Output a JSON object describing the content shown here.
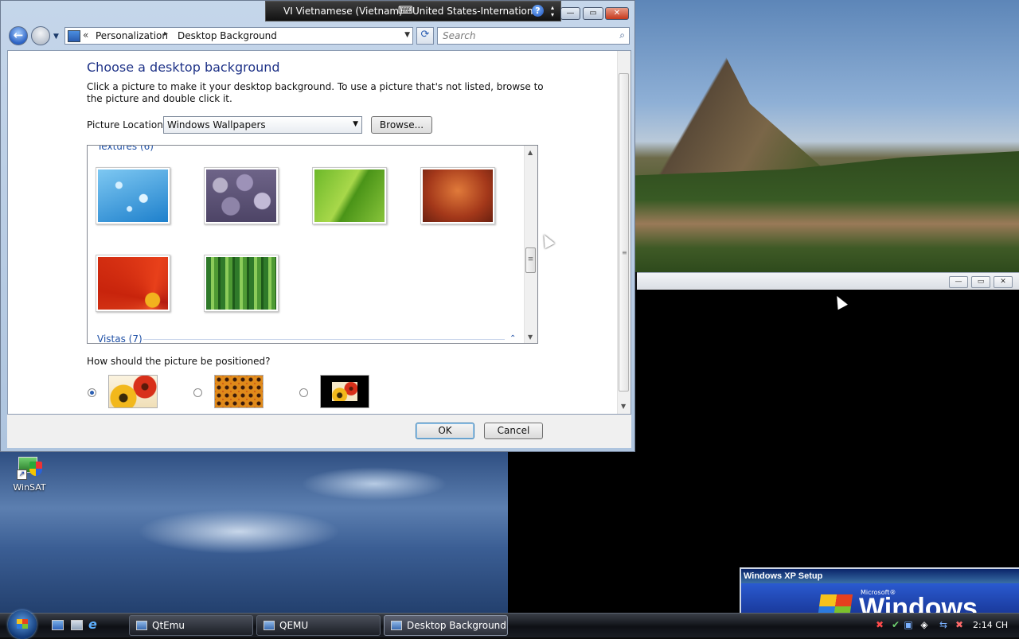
{
  "language_bar": {
    "input_language": "VI Vietnamese (Vietnam)",
    "keyboard_layout": "United States-International",
    "help": "?"
  },
  "window": {
    "controls": {
      "minimize": "—",
      "maximize": "▭",
      "close": "✕"
    },
    "address": {
      "chevron": "«",
      "crumbs": [
        "Personalization",
        "Desktop Background"
      ],
      "separator": "▸",
      "dropdown": "▼"
    },
    "refresh": "⟳",
    "search": {
      "placeholder": "Search",
      "icon": "⌕"
    },
    "heading": "Choose a desktop background",
    "description": "Click a picture to make it your desktop background. To use a picture that's not listed, browse to the picture and double click it.",
    "picture_location": {
      "label": "Picture Location",
      "value": "Windows Wallpapers",
      "arrow": "▼"
    },
    "browse_label": "Browse...",
    "gallery": {
      "groups": [
        {
          "title": "Textures (6)",
          "collapse": "⌃"
        },
        {
          "title": "Vistas (7)",
          "collapse": "⌃"
        }
      ],
      "thumbnails": [
        "water-drops",
        "pebbles",
        "green-leaf",
        "orange-fur",
        "red-daisy",
        "bamboo"
      ],
      "scroll_up": "▲",
      "scroll_down": "▼",
      "grip": "≡"
    },
    "position": {
      "question": "How should the picture be positioned?",
      "options": [
        "Fit to screen",
        "Tile",
        "Center"
      ],
      "selected": 0
    },
    "scroll": {
      "grip": "≡",
      "down": "▼"
    },
    "ok_label": "OK",
    "cancel_label": "Cancel"
  },
  "second_window": {
    "minimize": "—",
    "maximize": "▭",
    "close": "✕"
  },
  "desktop": {
    "icon_label": "WinSAT"
  },
  "xp_setup": {
    "title": "Windows XP Setup",
    "ms": "Microsoft®",
    "word": "Windows"
  },
  "taskbar": {
    "tasks": [
      {
        "label": "QtEmu"
      },
      {
        "label": "QEMU"
      },
      {
        "label": "Desktop Background"
      }
    ],
    "tray_icons": [
      "✖",
      "✔",
      "▣",
      "◈",
      "⇆",
      "✖"
    ],
    "clock": "2:14 CH"
  }
}
